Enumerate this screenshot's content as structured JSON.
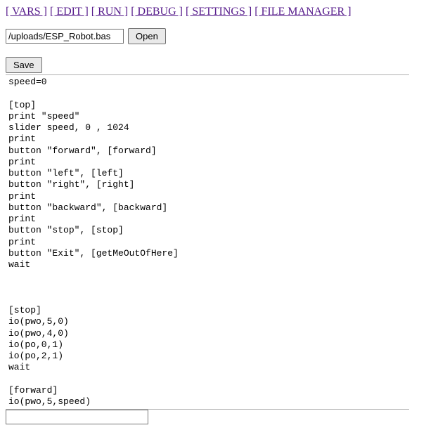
{
  "nav": {
    "vars": "[ VARS ]",
    "edit": "[ EDIT ]",
    "run": "[ RUN ]",
    "debug": "[ DEBUG ]",
    "settings": "[ SETTINGS ]",
    "filemgr": "[ FILE MANAGER ]"
  },
  "file": {
    "path": "/uploads/ESP_Robot.bas",
    "open_label": "Open"
  },
  "editor": {
    "save_label": "Save",
    "code": "speed=0\n\n[top]\nprint \"speed\"\nslider speed, 0 , 1024\nprint\nbutton \"forward\", [forward]\nprint\nbutton \"left\", [left]\nbutton \"right\", [right]\nprint\nbutton \"backward\", [backward]\nprint\nbutton \"stop\", [stop]\nprint\nbutton \"Exit\", [getMeOutOfHere]\nwait\n\n\n\n[stop]\nio(pwo,5,0)\nio(pwo,4,0)\nio(po,0,1)\nio(po,2,1)\nwait\n\n[forward]\nio(pwo,5,speed)"
  },
  "bottom": {
    "value": ""
  }
}
